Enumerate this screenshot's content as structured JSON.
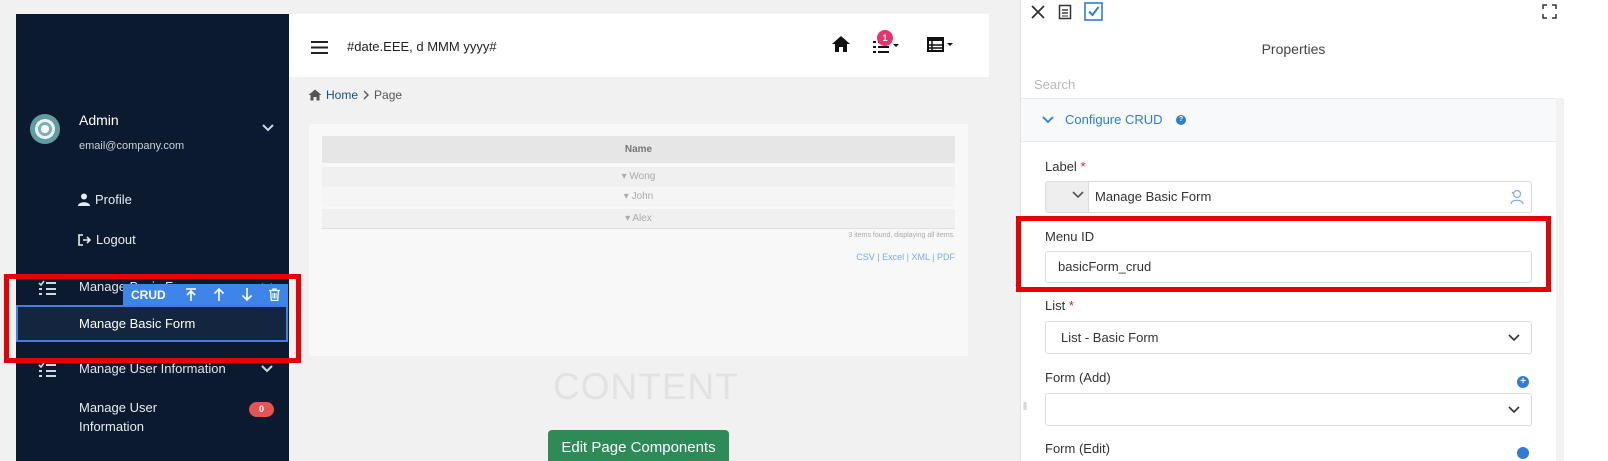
{
  "sidebar": {
    "user": {
      "name": "Admin",
      "email": "email@company.com"
    },
    "profile_label": "Profile",
    "logout_label": "Logout",
    "groups": [
      {
        "label": "Manage Basic Form",
        "items": [
          {
            "label": "Manage Basic Form",
            "selected": true
          }
        ]
      },
      {
        "label": "Manage User Information",
        "items": [
          {
            "label": "Manage User Information",
            "badge": "0"
          }
        ]
      }
    ],
    "background_color": "#0b1a2f"
  },
  "crud_toolbar": {
    "label": "CRUD",
    "buttons": [
      "move-to-top-icon",
      "move-up-icon",
      "move-down-icon",
      "trash-icon"
    ],
    "color": "#3d85e8"
  },
  "topbar": {
    "date_text": "#date.EEE, d MMM yyyy#",
    "tasks_badge": "1"
  },
  "breadcrumb": {
    "home": "Home",
    "current": "Page"
  },
  "content": {
    "table": {
      "column_header": "Name",
      "rows": [
        "Wong",
        "John",
        "Alex"
      ],
      "items_found": "3 items found, displaying all items.",
      "export_links": "CSV | Excel | XML | PDF"
    },
    "watermark": "CONTENT",
    "edit_button_label": "Edit Page Components"
  },
  "properties": {
    "title": "Properties",
    "search_placeholder": "Search",
    "section_title": "Configure CRUD",
    "fields": {
      "label": {
        "caption": "Label",
        "required_mark": "*",
        "value": "Manage Basic Form"
      },
      "menu_id": {
        "caption": "Menu ID",
        "value": "basicForm_crud"
      },
      "list": {
        "caption": "List",
        "required_mark": "*",
        "value": "List - Basic Form"
      },
      "form_add": {
        "caption": "Form (Add)",
        "value": ""
      },
      "form_edit": {
        "caption": "Form (Edit)"
      }
    },
    "accent_color": "#2f7cd6"
  },
  "highlight_color": "#e80000"
}
